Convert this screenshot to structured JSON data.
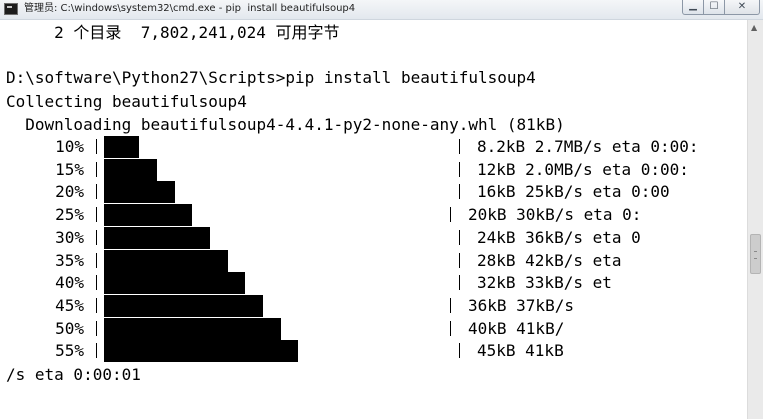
{
  "window": {
    "title": "管理员: C:\\windows\\system32\\cmd.exe - pip  install beautifulsoup4",
    "controls": {
      "minimize": "▁",
      "maximize": "☐",
      "close": "✕"
    }
  },
  "console": {
    "lines": [
      "     2 个目录  7,802,241,024 可用字节",
      "",
      "D:\\software\\Python27\\Scripts>pip install beautifulsoup4",
      "Collecting beautifulsoup4",
      "  Downloading beautifulsoup4-4.4.1-py2-none-any.whl (81kB)"
    ],
    "progress_rows": [
      {
        "percent": "10%",
        "progress": 0.1,
        "rate": "8.2kB 2.7MB/s eta 0:00:"
      },
      {
        "percent": "15%",
        "progress": 0.15,
        "rate": "12kB 2.0MB/s eta 0:00:"
      },
      {
        "percent": "20%",
        "progress": 0.2,
        "rate": "16kB 25kB/s eta 0:00"
      },
      {
        "percent": "25%",
        "progress": 0.25,
        "rate": "20kB 30kB/s eta 0:"
      },
      {
        "percent": "30%",
        "progress": 0.3,
        "rate": "24kB 36kB/s eta 0"
      },
      {
        "percent": "35%",
        "progress": 0.35,
        "rate": "28kB 42kB/s eta"
      },
      {
        "percent": "40%",
        "progress": 0.4,
        "rate": "32kB 33kB/s et"
      },
      {
        "percent": "45%",
        "progress": 0.45,
        "rate": "36kB 37kB/s"
      },
      {
        "percent": "50%",
        "progress": 0.5,
        "rate": "40kB 41kB/"
      },
      {
        "percent": "55%",
        "progress": 0.55,
        "rate": "45kB 41kB"
      }
    ],
    "trailing_line": "/s eta 0:00:01"
  },
  "colors": {
    "background": "#ffffff",
    "text": "#000000",
    "titlebar": "#e3e8ee"
  },
  "icons": [
    "cmd-app-icon",
    "minimize-icon",
    "maximize-icon",
    "close-icon",
    "scroll-up-icon"
  ]
}
